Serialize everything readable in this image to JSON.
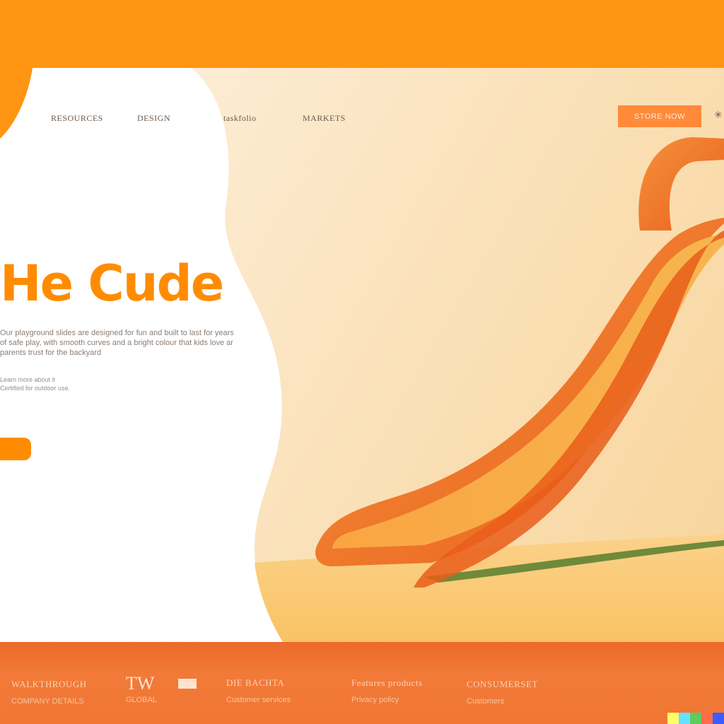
{
  "nav": {
    "items": [
      {
        "label": "RESOURCES"
      },
      {
        "label": "DESIGN"
      },
      {
        "label": "taskfolio"
      },
      {
        "label": "MARKETS"
      }
    ],
    "cta_label": "STORE NOW"
  },
  "hero": {
    "headline": "He Cude",
    "body_lines": [
      "Our playground slides are designed for fun and built to last for years",
      "of safe play, with smooth curves and a bright colour that kids love and",
      "parents trust for the backyard",
      "Learn more about it",
      "Certified for outdoor use."
    ]
  },
  "footer": {
    "columns": [
      {
        "title": "WALKTHROUGH",
        "sub": "COMPANY DETAILS"
      },
      {
        "title": "TW",
        "sub": "GLOBAL"
      },
      {
        "title": "DIE BACHTA",
        "sub": "Customer services"
      },
      {
        "title": "Features products",
        "sub": "Privacy policy"
      },
      {
        "title": "CONSUMERSET",
        "sub": "Customers"
      }
    ]
  },
  "colors": {
    "accent": "#ff8c00",
    "band": "#ff9512",
    "footer": "#f07633",
    "slide": "#f47a2c"
  },
  "swatches": [
    "#ffff66",
    "#66e0ff",
    "#5ccc5c",
    "#ff6a4d",
    "#3d5cff"
  ]
}
